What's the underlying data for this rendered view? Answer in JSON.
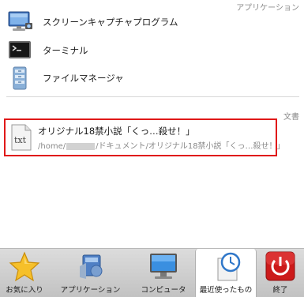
{
  "sections": {
    "apps_header": "アプリケーション",
    "docs_header": "文書"
  },
  "apps": [
    {
      "label": "スクリーンキャプチャプログラム",
      "icon": "screen-capture-icon"
    },
    {
      "label": "ターミナル",
      "icon": "terminal-icon"
    },
    {
      "label": "ファイルマネージャ",
      "icon": "file-manager-icon"
    }
  ],
  "document": {
    "title": "オリジナル18禁小説「くっ…殺せ！」",
    "path_prefix": "/home/",
    "path_suffix": "/ドキュメント/オリジナル18禁小説「くっ…殺せ！」",
    "icon": "text-file-icon",
    "icon_text": "txt",
    "highlight_color": "#e01818"
  },
  "tabs": [
    {
      "label": "お気に入り",
      "icon": "star-icon"
    },
    {
      "label": "アプリケーション",
      "icon": "applications-icon"
    },
    {
      "label": "コンピュータ",
      "icon": "computer-icon"
    },
    {
      "label": "最近使ったもの",
      "icon": "recent-clock-icon",
      "active": true
    },
    {
      "label": "終了",
      "icon": "power-icon"
    }
  ]
}
